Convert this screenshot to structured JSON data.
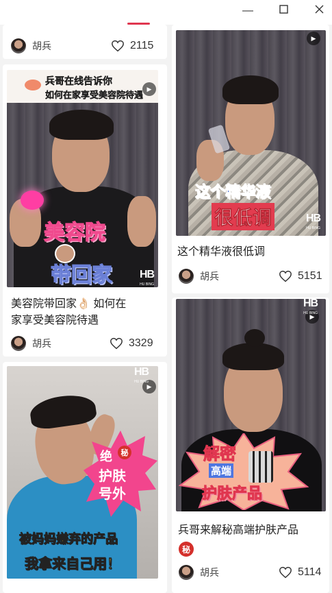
{
  "window": {
    "minimize_glyph": "—",
    "maximize_glyph": "☐",
    "close_glyph": "✕"
  },
  "cards": [
    {
      "id": "top-left-partial",
      "author": "胡兵",
      "likes": "2115"
    },
    {
      "id": "essence",
      "overlay_line1": "这个精华液",
      "overlay_line2": "很低调",
      "title": "这个精华液很低调",
      "author": "胡兵",
      "likes": "5151"
    },
    {
      "id": "salon",
      "overlay_top_line1": "兵哥在线告诉你",
      "overlay_top_line2": "如何在家享受美容院待遇",
      "overlay_line1": "美容院",
      "overlay_line2": "带回家",
      "title_line1": "美容院带回家👌🏻 如何在",
      "title_line2": "家享受美容院待遇",
      "author": "胡兵",
      "likes": "3329"
    },
    {
      "id": "secret-products",
      "overlay_line1": "解密",
      "overlay_line2": "高端",
      "overlay_line3": "护肤产品",
      "title": "兵哥来解秘高端护肤产品",
      "badge": "秘",
      "author": "胡兵",
      "likes": "5114"
    },
    {
      "id": "extra",
      "overlay_badge_line1": "绝",
      "overlay_badge_secret": "秘",
      "overlay_badge_line2": "护肤",
      "overlay_badge_line3": "号外",
      "overlay_bottom_line1": "被妈妈嫌弃的产品",
      "overlay_bottom_line2": "我拿来自己用！"
    }
  ],
  "logo": {
    "mark": "HB",
    "sub": "HU BING"
  },
  "colors": {
    "accent": "#e0364f",
    "pink_text": "#f04a8e",
    "badge_red": "#d4302b"
  },
  "icons": {
    "like": "heart-outline-icon",
    "play": "play-icon"
  }
}
